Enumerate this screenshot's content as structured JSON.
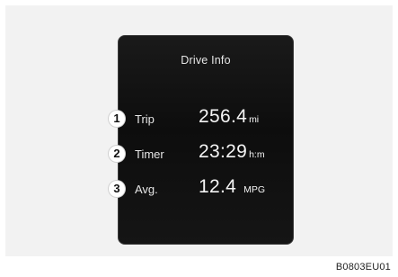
{
  "display": {
    "title": "Drive Info",
    "rows": [
      {
        "callout": "1",
        "label": "Trip",
        "value": "256.4",
        "unit": "mi"
      },
      {
        "callout": "2",
        "label": "Timer",
        "value": "23:29",
        "unit": "h:m"
      },
      {
        "callout": "3",
        "label": "Avg.",
        "value": "12.4",
        "unit": "MPG"
      }
    ]
  },
  "figure_code": "B0803EU01",
  "colors": {
    "screen_background": "#111111",
    "page_background": "#f2f2f2",
    "text": "#e6e6e6"
  }
}
